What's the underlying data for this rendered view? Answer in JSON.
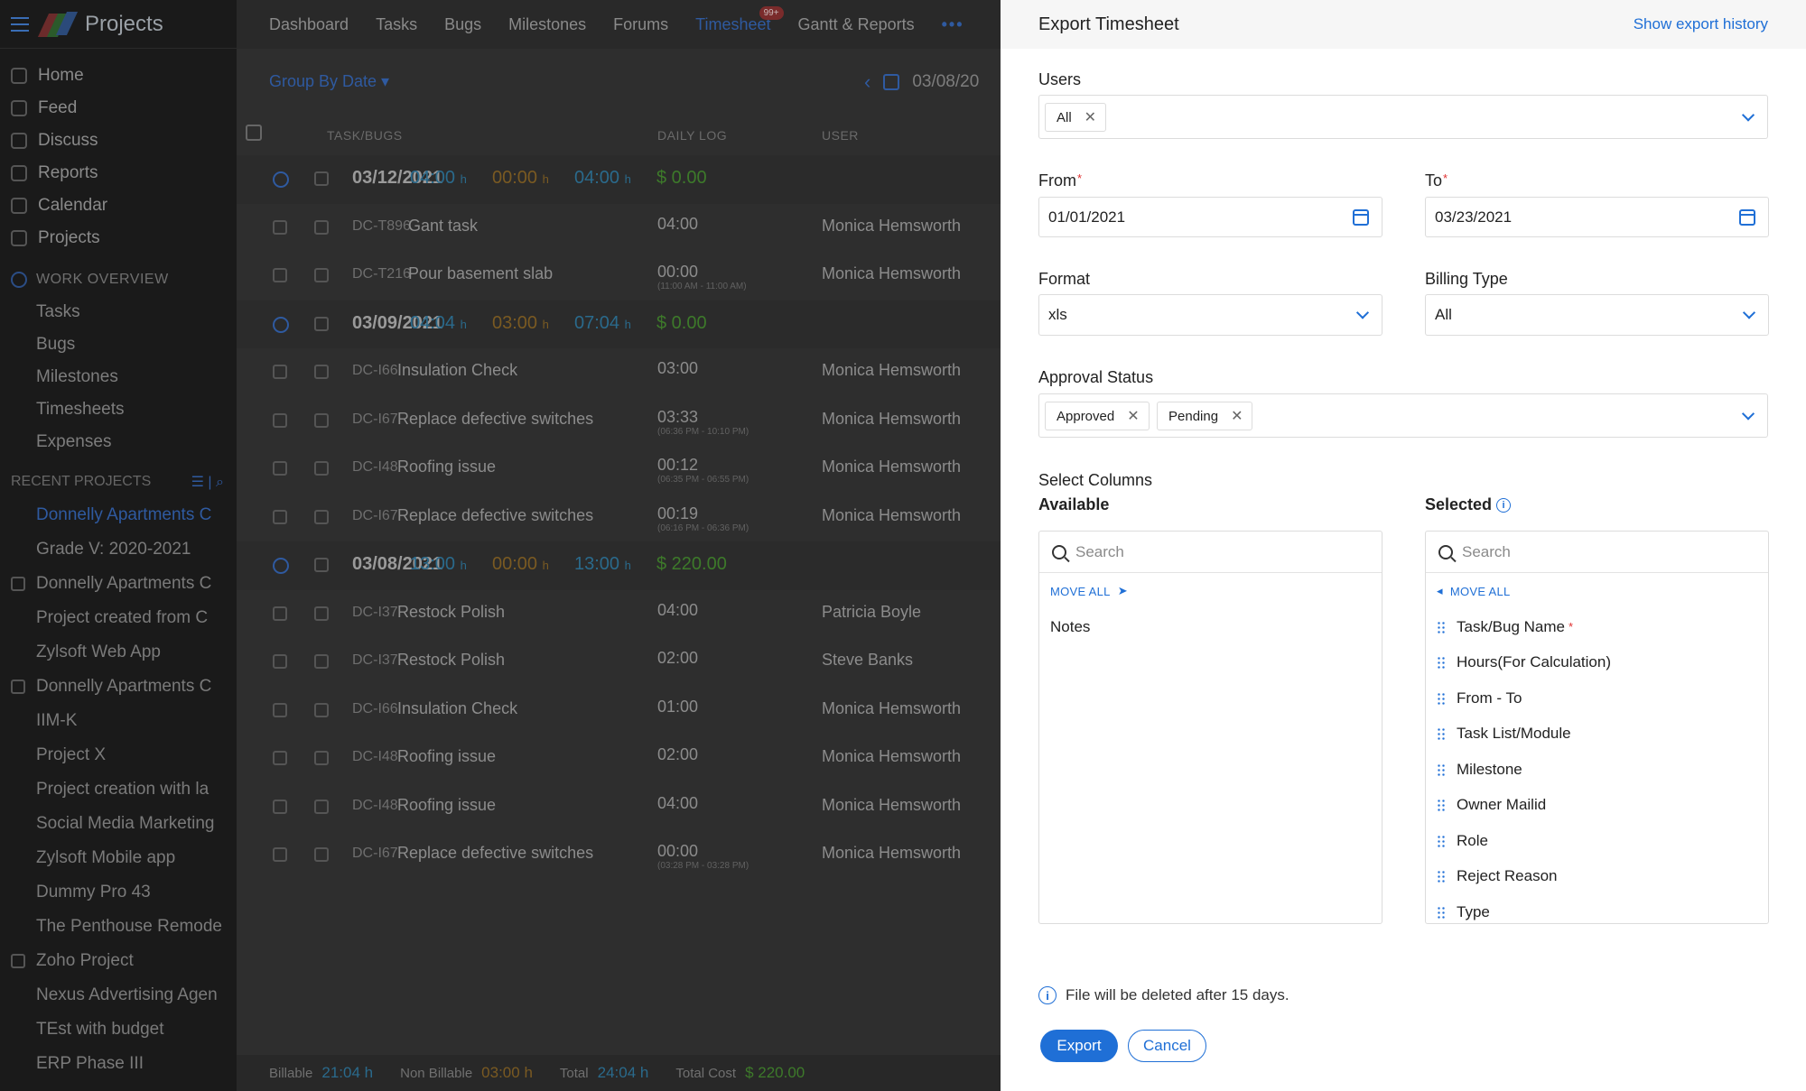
{
  "sidebar": {
    "title": "Projects",
    "nav": [
      "Home",
      "Feed",
      "Discuss",
      "Reports",
      "Calendar",
      "Projects"
    ],
    "work_overview_label": "WORK OVERVIEW",
    "work_items": [
      "Tasks",
      "Bugs",
      "Milestones",
      "Timesheets",
      "Expenses"
    ],
    "recent_label": "RECENT PROJECTS",
    "projects": [
      "Donnelly Apartments C",
      "Grade V: 2020-2021",
      "Donnelly Apartments C",
      "Project created from C",
      "Zylsoft Web App",
      "Donnelly Apartments C",
      "IIM-K",
      "Project X",
      "Project creation with la",
      "Social Media Marketing",
      "Zylsoft Mobile app",
      "Dummy Pro 43",
      "The Penthouse Remode",
      "Zoho Project",
      "Nexus Advertising Agen",
      "TEst with budget",
      "ERP Phase III"
    ]
  },
  "topnav": {
    "tabs": [
      "Dashboard",
      "Tasks",
      "Bugs",
      "Milestones",
      "Forums",
      "Timesheet",
      "Gantt & Reports"
    ],
    "badge": "99+",
    "more": "•••"
  },
  "toolbar": {
    "group_by": "Group By Date ▾",
    "date": "03/08/20"
  },
  "table": {
    "headers": [
      "TASK/BUGS",
      "DAILY LOG",
      "USER"
    ],
    "groups": [
      {
        "date": "03/12/2021",
        "billable": "04:00",
        "nonbillable": "00:00",
        "total": "04:00",
        "cost": "$ 0.00",
        "rows": [
          {
            "code": "DC-T896",
            "task": "Gant task",
            "log": "04:00",
            "range": "",
            "user": "Monica Hemsworth"
          },
          {
            "code": "DC-T216",
            "task": "Pour basement slab",
            "log": "00:00",
            "range": "(11:00 AM - 11:00 AM)",
            "user": "Monica Hemsworth"
          }
        ]
      },
      {
        "date": "03/09/2021",
        "billable": "04:04",
        "nonbillable": "03:00",
        "total": "07:04",
        "cost": "$ 0.00",
        "rows": [
          {
            "code": "DC-I66",
            "task": "Insulation Check",
            "log": "03:00",
            "range": "",
            "user": "Monica Hemsworth"
          },
          {
            "code": "DC-I67",
            "task": "Replace defective switches",
            "log": "03:33",
            "range": "(06:36 PM - 10:10 PM)",
            "user": "Monica Hemsworth"
          },
          {
            "code": "DC-I48",
            "task": "Roofing issue",
            "log": "00:12",
            "range": "(06:35 PM - 06:55 PM)",
            "user": "Monica Hemsworth"
          },
          {
            "code": "DC-I67",
            "task": "Replace defective switches",
            "log": "00:19",
            "range": "(06:16 PM - 06:36 PM)",
            "user": "Monica Hemsworth"
          }
        ]
      },
      {
        "date": "03/08/2021",
        "billable": "13:00",
        "nonbillable": "00:00",
        "total": "13:00",
        "cost": "$ 220.00",
        "rows": [
          {
            "code": "DC-I37",
            "task": "Restock Polish",
            "log": "04:00",
            "range": "",
            "user": "Patricia Boyle"
          },
          {
            "code": "DC-I37",
            "task": "Restock Polish",
            "log": "02:00",
            "range": "",
            "user": "Steve Banks"
          },
          {
            "code": "DC-I66",
            "task": "Insulation Check",
            "log": "01:00",
            "range": "",
            "user": "Monica Hemsworth"
          },
          {
            "code": "DC-I48",
            "task": "Roofing issue",
            "log": "02:00",
            "range": "",
            "user": "Monica Hemsworth"
          },
          {
            "code": "DC-I48",
            "task": "Roofing issue",
            "log": "04:00",
            "range": "",
            "user": "Monica Hemsworth"
          },
          {
            "code": "DC-I67",
            "task": "Replace defective switches",
            "log": "00:00",
            "range": "(03:28 PM - 03:28 PM)",
            "user": "Monica Hemsworth"
          }
        ]
      }
    ],
    "hour_unit": "h"
  },
  "footer": {
    "billable_label": "Billable",
    "billable": "21:04",
    "nonbillable_label": "Non Billable",
    "nonbillable": "03:00",
    "total_label": "Total",
    "total": "24:04",
    "cost_label": "Total Cost",
    "cost": "$ 220.00",
    "unit": "h"
  },
  "export": {
    "title": "Export Timesheet",
    "history_link": "Show export history",
    "users_label": "Users",
    "users_chips": [
      "All"
    ],
    "from_label": "From",
    "from_value": "01/01/2021",
    "to_label": "To",
    "to_value": "03/23/2021",
    "format_label": "Format",
    "format_value": "xls",
    "billing_label": "Billing Type",
    "billing_value": "All",
    "approval_label": "Approval Status",
    "approval_chips": [
      "Approved",
      "Pending"
    ],
    "select_columns_label": "Select Columns",
    "available_label": "Available",
    "selected_label": "Selected",
    "search_placeholder": "Search",
    "move_all": "MOVE ALL",
    "available_items": [
      "Notes"
    ],
    "selected_items": [
      "Task/Bug Name",
      "Hours(For Calculation)",
      "From - To",
      "Task List/Module",
      "Milestone",
      "Owner Mailid",
      "Role",
      "Reject Reason",
      "Type"
    ],
    "note": "File will be deleted after 15 days.",
    "export_button": "Export",
    "cancel_button": "Cancel"
  },
  "colors": {
    "accent": "#1f6fd6",
    "billable": "#2a6a8c",
    "nonbillable": "#7a5a22",
    "cost": "#3d7a2a",
    "required": "#e03030"
  }
}
